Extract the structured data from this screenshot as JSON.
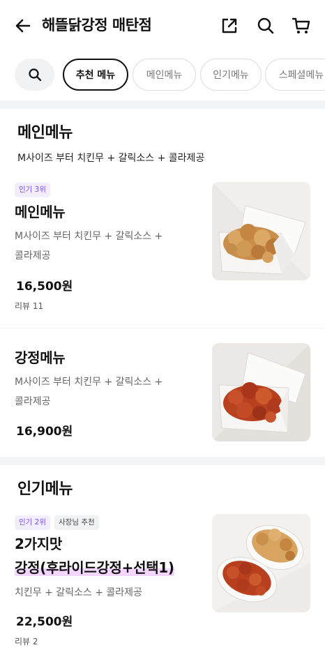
{
  "header": {
    "title": "해뜰닭강정 매탄점",
    "icons": [
      "back-arrow-icon",
      "share-icon",
      "search-icon",
      "cart-icon"
    ]
  },
  "tabs": {
    "search_icon": "search-icon",
    "items": [
      {
        "label": "추천 메뉴",
        "active": true
      },
      {
        "label": "메인메뉴",
        "active": false
      },
      {
        "label": "인기메뉴",
        "active": false
      },
      {
        "label": "스페셜메뉴",
        "active": false
      }
    ]
  },
  "sections": [
    {
      "title": "메인메뉴",
      "description": "M사이즈 부터 치킨무 + 갈릭소스 + 콜라제공",
      "items": [
        {
          "badges": [
            "인기 3위"
          ],
          "name": "메인메뉴",
          "description_line1": "M사이즈 부터 치킨무 + 갈릭소스 +",
          "description_line2": "콜라제공",
          "price": "16,500원",
          "reviews": "리뷰 11"
        },
        {
          "name": "강정메뉴",
          "description_line1": "M사이즈 부터 치킨무 + 갈릭소스 +",
          "description_line2": "콜라제공",
          "price": "16,900원"
        }
      ]
    },
    {
      "title": "인기메뉴",
      "items": [
        {
          "badges": [
            "인기 2위",
            "사장님 추천"
          ],
          "name_line1": "2가지맛",
          "name_line2": "강정(후라이드강정+선택1)",
          "description": "치킨무 + 갈릭소스 + 콜라제공",
          "price": "22,500원",
          "reviews": "리뷰 2"
        }
      ]
    }
  ],
  "colors": {
    "accent_purple": "#7a4ff0",
    "badge_purple_bg": "#f2edff",
    "divider": "#f3f4f6",
    "highlight": "#f3d6ff"
  }
}
